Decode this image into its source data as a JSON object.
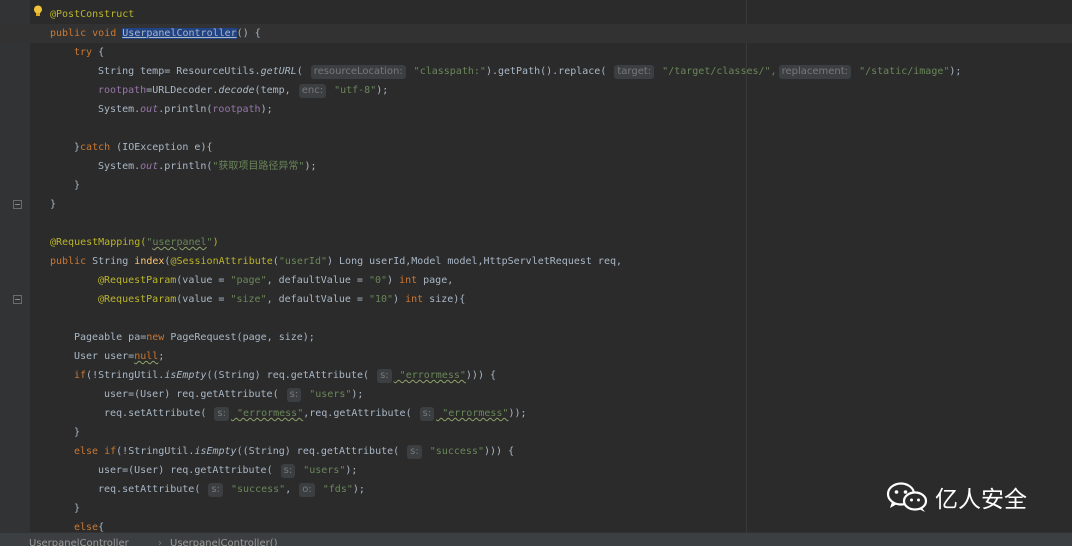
{
  "code": {
    "l1": {
      "ann": "@PostConstruct"
    },
    "l2": {
      "kw1": "public",
      "kw2": "void",
      "name": "UserpanelController",
      "rest": "() {"
    },
    "l3": {
      "kw": "try",
      "rest": " {"
    },
    "l4": {
      "a": "String temp= ResourceUtils.",
      "m": "getURL",
      "b": "( ",
      "h1": "resourceLocation:",
      "s1": " \"classpath:\"",
      "c": ").getPath().replace( ",
      "h2": "target:",
      "s2": " \"/target/classes/\",",
      "h3": "replacement:",
      "s3": " \"/static/image\"",
      "d": ");"
    },
    "l5": {
      "f": "rootpath",
      "a": "=URLDecoder.",
      "m": "decode",
      "b": "(temp, ",
      "h": "enc:",
      "s": " \"utf-8\"",
      "c": ");"
    },
    "l6": {
      "a": "System.",
      "f": "out",
      "b": ".println(",
      "f2": "rootpath",
      "c": ");"
    },
    "l8": {
      "a": "}",
      "kw": "catch",
      "b": " (IOException e){"
    },
    "l9": {
      "a": "System.",
      "f": "out",
      "b": ".println(",
      "s": "\"获取项目路径异常\"",
      "c": ");"
    },
    "l10": {
      "a": "}"
    },
    "l11": {
      "a": "}"
    },
    "l13": {
      "ann": "@RequestMapping(",
      "s": "\"",
      "sq": "userpanel",
      "s2": "\"",
      "ann2": ")"
    },
    "l14": {
      "kw": "public",
      "a": " String ",
      "m": "index",
      "b": "(",
      "ann": "@SessionAttribute",
      "c": "(",
      "s": "\"userId\"",
      "d": ") Long userId,Model model,HttpServletRequest req,"
    },
    "l15": {
      "ann": "@RequestParam",
      "a": "(value = ",
      "s1": "\"page\"",
      "b": ", defaultValue = ",
      "s2": "\"0\"",
      "c": ") ",
      "kw": "int",
      "d": " page,"
    },
    "l16": {
      "ann": "@RequestParam",
      "a": "(value = ",
      "s1": "\"size\"",
      "b": ", defaultValue = ",
      "s2": "\"10\"",
      "c": ") ",
      "kw": "int",
      "d": " size){"
    },
    "l18": {
      "a": "Pageable pa=",
      "kw": "new",
      "b": " PageRequest(page, size);"
    },
    "l19": {
      "a": "User user=",
      "kw": "null",
      "b": ";"
    },
    "l20": {
      "kw": "if",
      "a": "(!StringUtil.",
      "m": "isEmpty",
      "b": "((String) req.getAttribute( ",
      "h": "s:",
      "s": " \"errormess\"",
      "c": "))) {"
    },
    "l21": {
      "a": "user=(User) req.getAttribute( ",
      "h": "s:",
      "s": " \"users\"",
      "c": ");"
    },
    "l22": {
      "a": "req.setAttribute( ",
      "h1": "s:",
      "s1": " \"errormess\"",
      "b": ",req.getAttribute( ",
      "h2": "s:",
      "s2": " \"errormess\"",
      "c": "));"
    },
    "l23": {
      "a": "}"
    },
    "l24": {
      "kw1": "else",
      "kw2": " if",
      "a": "(!StringUtil.",
      "m": "isEmpty",
      "b": "((String) req.getAttribute( ",
      "h": "s:",
      "s": " \"success\"",
      "c": "))) {"
    },
    "l25": {
      "a": "user=(User) req.getAttribute( ",
      "h": "s:",
      "s": " \"users\"",
      "c": ");"
    },
    "l26": {
      "a": "req.setAttribute( ",
      "h1": "s:",
      "s1": " \"success\"",
      "b": ", ",
      "h2": "o:",
      "s2": " \"fds\"",
      "c": ");"
    },
    "l27": {
      "a": "}"
    },
    "l28": {
      "kw": "else",
      "a": "{"
    }
  },
  "breadcrumb": [
    "UserpanelController",
    "UserpanelController()"
  ],
  "breadcrumb_sep": "›",
  "watermark": "亿人安全"
}
